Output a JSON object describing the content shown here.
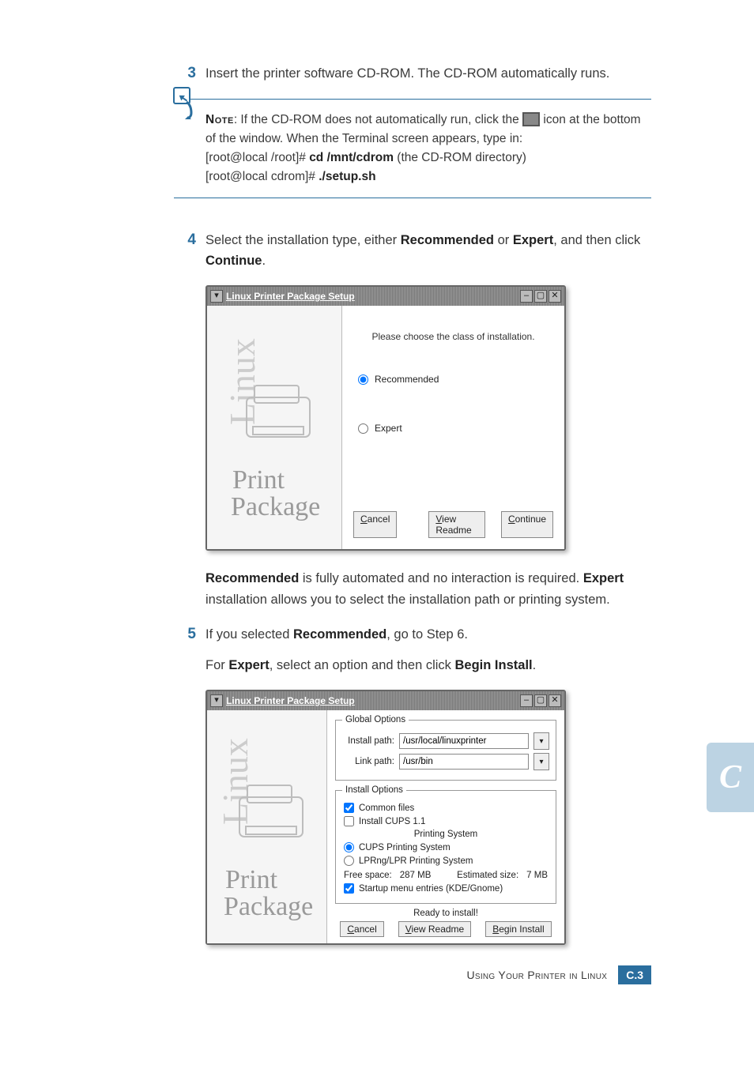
{
  "steps": {
    "s3": {
      "num": "3",
      "text_a": "Insert the printer software CD-ROM. The CD-ROM automatically runs."
    },
    "s4": {
      "num": "4",
      "text_a": "Select the installation type, either ",
      "bold_1": "Recommended",
      "text_b": " or ",
      "bold_2": "Expert",
      "text_c": ", and then click ",
      "bold_3": "Continue",
      "text_d": "."
    },
    "s4_after": {
      "bold_1": "Recommended",
      "text_a": " is fully automated and no interaction is required. ",
      "bold_2": "Expert",
      "text_b": " installation allows you to select the installation path or printing system."
    },
    "s5": {
      "num": "5",
      "text_a": "If you selected ",
      "bold_1": "Recommended",
      "text_b": ", go to Step 6."
    },
    "s5_after": {
      "text_a": "For ",
      "bold_1": "Expert",
      "text_b": ", select an option and then click ",
      "bold_2": "Begin Install",
      "text_c": "."
    }
  },
  "note": {
    "label": "Note",
    "text_a": ": If the CD-ROM does not automatically run, click the ",
    "text_b": " icon at the bottom of the window. When the Terminal screen appears, type in:",
    "line1_a": "[root@local /root]# ",
    "line1_b": "cd /mnt/cdrom",
    "line1_c": " (the CD-ROM directory)",
    "line2_a": "[root@local cdrom]# ",
    "line2_b": "./setup.sh"
  },
  "ss1": {
    "title": "Linux Printer Package Setup",
    "brand_top": "Linux",
    "brand_bot_1": "Print",
    "brand_bot_2": "Package",
    "msg": "Please choose the class of installation.",
    "opt_recommended": "Recommended",
    "opt_expert": "Expert",
    "btn_cancel_u": "C",
    "btn_cancel_r": "ancel",
    "btn_view_u": "V",
    "btn_view_r": "iew Readme",
    "btn_cont_u": "C",
    "btn_cont_r": "ontinue"
  },
  "ss2": {
    "title": "Linux Printer Package Setup",
    "brand_top": "Linux",
    "brand_bot_1": "Print",
    "brand_bot_2": "Package",
    "legend_global": "Global Options",
    "lbl_install_path": "Install path:",
    "val_install_path": "/usr/local/linuxprinter",
    "lbl_link_path": "Link path:",
    "val_link_path": "/usr/bin",
    "legend_install": "Install Options",
    "chk_common": "Common files",
    "chk_cups": "Install CUPS 1.1",
    "printing_system": "Printing System",
    "opt_cups_ps": "CUPS Printing System",
    "opt_lprng": "LPRng/LPR Printing System",
    "free_space_lab": "Free space:",
    "free_space_val": "287 MB",
    "est_size_lab": "Estimated size:",
    "est_size_val": "7 MB",
    "chk_startup": "Startup menu entries (KDE/Gnome)",
    "ready": "Ready to install!",
    "btn_cancel_u": "C",
    "btn_cancel_r": "ancel",
    "btn_view_u": "V",
    "btn_view_r": "iew Readme",
    "btn_begin_u": "B",
    "btn_begin_r": "egin Install"
  },
  "tab": {
    "letter": "C"
  },
  "footer": {
    "text": "Using Your Printer in Linux",
    "badge_letter": "C.",
    "badge_num": "3"
  }
}
